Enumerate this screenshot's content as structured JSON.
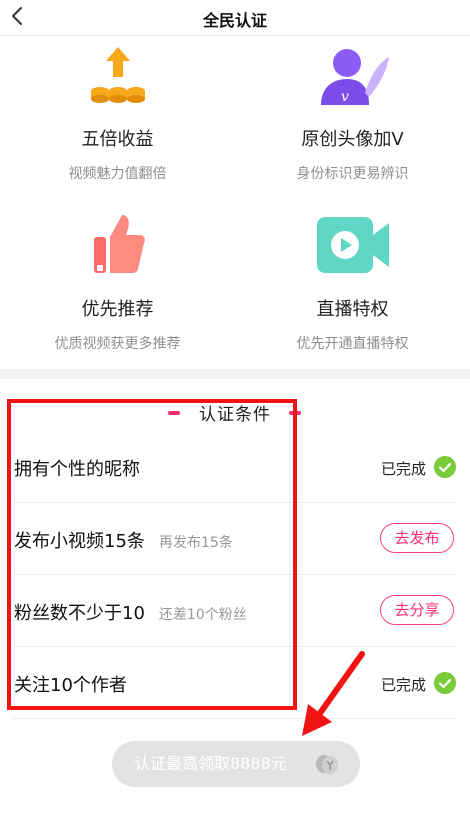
{
  "header": {
    "title": "全民认证",
    "back_icon": "chevron-left-icon"
  },
  "benefits": [
    {
      "title": "五倍收益",
      "desc": "视频魅力值翻倍",
      "icon": "coins-up-icon"
    },
    {
      "title": "原创头像加V",
      "desc": "身份标识更易辨识",
      "icon": "avatar-v-icon"
    },
    {
      "title": "优先推荐",
      "desc": "优质视频获更多推荐",
      "icon": "thumbs-up-icon"
    },
    {
      "title": "直播特权",
      "desc": "优先开通直播特权",
      "icon": "video-camera-icon"
    }
  ],
  "conditions": {
    "title": "认证条件",
    "items": [
      {
        "label": "拥有个性的昵称",
        "hint": "",
        "status": "已完成"
      },
      {
        "label": "发布小视频15条",
        "hint": "再发布15条",
        "action": "去发布"
      },
      {
        "label": "粉丝数不少于10",
        "hint": "还差10个粉丝",
        "action": "去分享"
      },
      {
        "label": "关注10个作者",
        "hint": "",
        "status": "已完成"
      }
    ]
  },
  "cta": {
    "label": "认证最高领取8888元"
  },
  "colors": {
    "accent": "#ff2d6f",
    "success": "#78cc3a",
    "annotation": "#f01414",
    "disabled": "#e3e3e3"
  }
}
